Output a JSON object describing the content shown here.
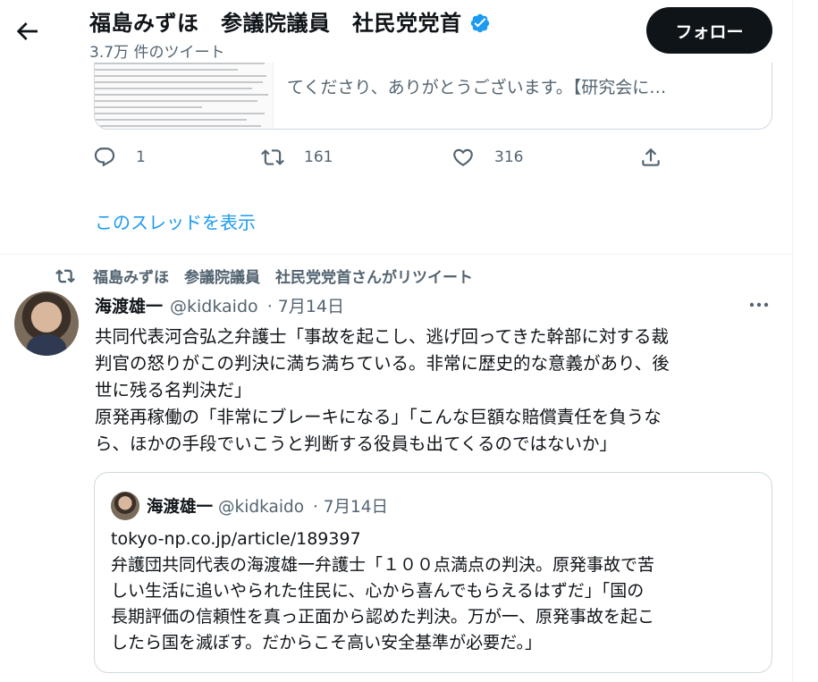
{
  "header": {
    "name": "福島みずほ　参議院議員　社民党党首",
    "tweet_count": "3.7万 件のツイート",
    "follow_label": "フォロー"
  },
  "prev_tweet": {
    "card_text": "てくださり、ありがとうございます。【研究会に…",
    "reply_count": "1",
    "retweet_count": "161",
    "like_count": "316",
    "show_thread": "このスレッドを表示"
  },
  "retweet": {
    "retweeted_by": "福島みずほ　参議院議員　社民党党首さんがリツイート",
    "author_name": "海渡雄一",
    "author_handle": "@kidkaido",
    "date": "· 7月14日",
    "body_lines": [
      "共同代表河合弘之弁護士「事故を起こし、逃げ回ってきた幹部に対する裁",
      "判官の怒りがこの判決に満ち満ちている。非常に歴史的な意義があり、後",
      "世に残る名判決だ」",
      "原発再稼働の「非常にブレーキになる」「こんな巨額な賠償責任を負うな",
      "ら、ほかの手段でいこうと判断する役員も出てくるのではないか」"
    ]
  },
  "quote": {
    "author_name": "海渡雄一",
    "author_handle": "@kidkaido",
    "date": "· 7月14日",
    "body_lines": [
      "tokyo-np.co.jp/article/189397",
      "弁護団共同代表の海渡雄一弁護士「１００点満点の判決。原発事故で苦",
      "しい生活に追いやられた住民に、心から喜んでもらえるはずだ」「国の",
      "長期評価の信頼性を真っ正面から認めた判決。万が一、原発事故を起こ",
      "したら国を滅ぼす。だからこそ高い安全基準が必要だ。」"
    ]
  },
  "icons": {
    "back": "arrow-left-icon",
    "verified": "verified-badge-icon",
    "reply": "reply-icon",
    "retweet": "retweet-icon",
    "like": "heart-icon",
    "share": "share-icon",
    "more": "more-icon"
  },
  "colors": {
    "accent": "#1d9bf0",
    "secondary_text": "#536471",
    "primary_text": "#0f1419"
  }
}
